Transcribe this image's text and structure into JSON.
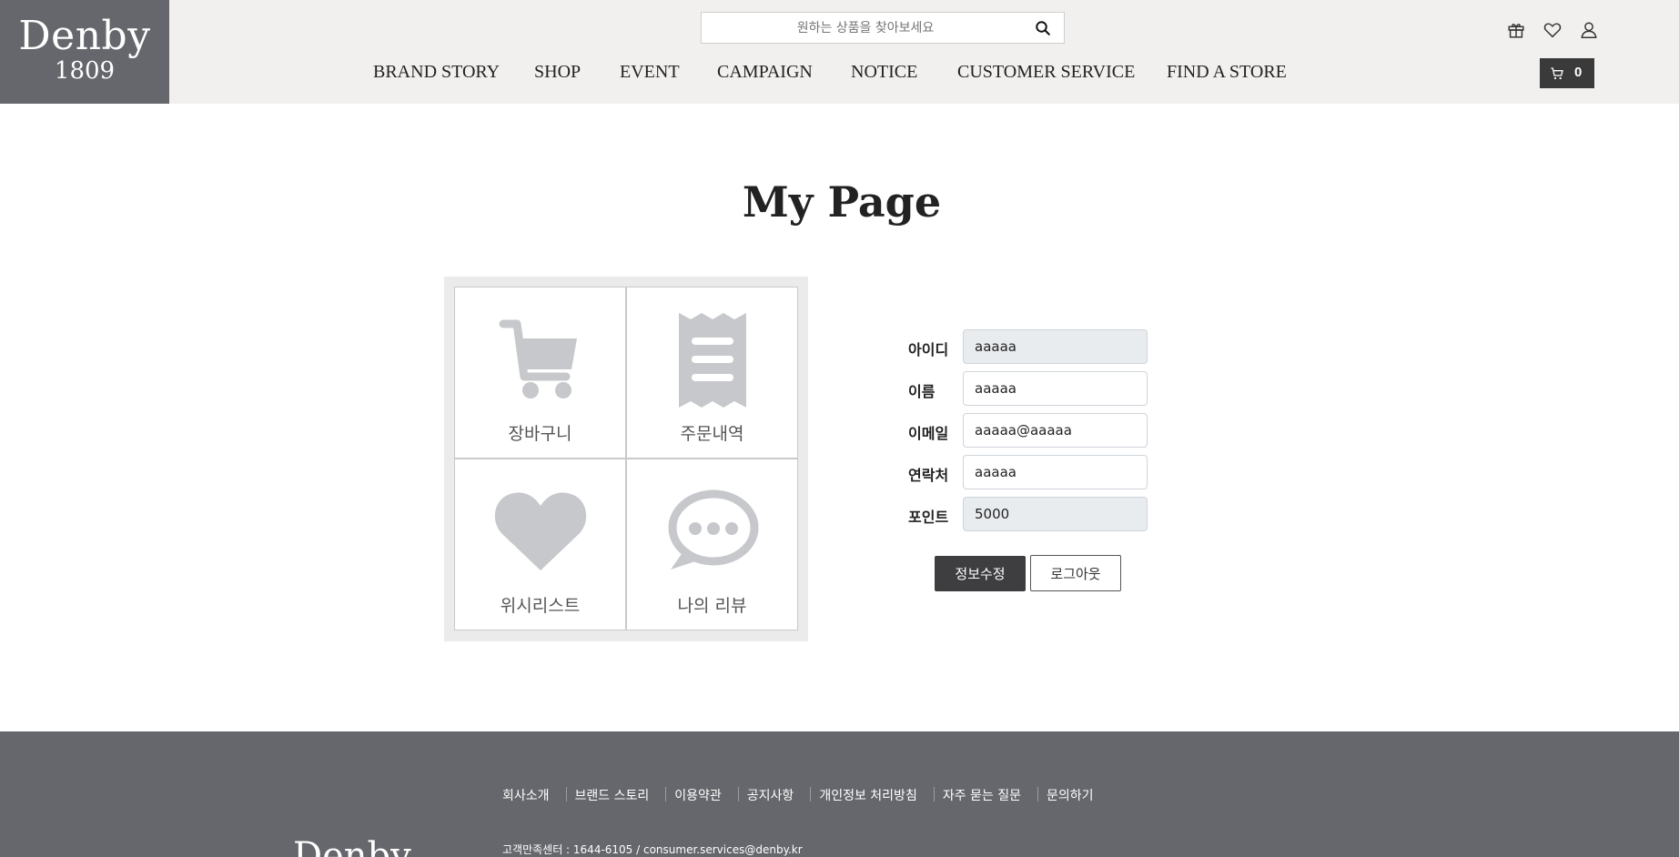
{
  "brand": {
    "name": "Denby",
    "year": "1809"
  },
  "search": {
    "placeholder": "원하는 상품을 찾아보세요"
  },
  "header_icons": [
    "gift-icon",
    "heart-icon",
    "user-icon"
  ],
  "cart": {
    "count": "0"
  },
  "nav": {
    "items": [
      {
        "label": "BRAND STORY"
      },
      {
        "label": "SHOP"
      },
      {
        "label": "EVENT"
      },
      {
        "label": "CAMPAIGN"
      },
      {
        "label": "NOTICE"
      },
      {
        "label": "CUSTOMER SERVICE"
      },
      {
        "label": "FIND A STORE"
      }
    ]
  },
  "page": {
    "title": "My Page"
  },
  "menu": {
    "tiles": [
      {
        "label": "장바구니",
        "icon": "cart-icon"
      },
      {
        "label": "주문내역",
        "icon": "receipt-icon"
      },
      {
        "label": "위시리스트",
        "icon": "heart-icon"
      },
      {
        "label": "나의 리뷰",
        "icon": "chat-icon"
      }
    ]
  },
  "profile": {
    "fields": [
      {
        "label": "아이디",
        "value": "aaaaa",
        "readonly": true
      },
      {
        "label": "이름",
        "value": "aaaaa",
        "readonly": false
      },
      {
        "label": "이메일",
        "value": "aaaaa@aaaaa",
        "readonly": false
      },
      {
        "label": "연락처",
        "value": "aaaaa",
        "readonly": false
      },
      {
        "label": "포인트",
        "value": "5000",
        "readonly": true
      }
    ],
    "edit_label": "정보수정",
    "logout_label": "로그아웃"
  },
  "footer": {
    "links": [
      {
        "label": "회사소개"
      },
      {
        "label": "브랜드 스토리"
      },
      {
        "label": "이용약관"
      },
      {
        "label": "공지사항"
      },
      {
        "label": "개인정보 처리방침"
      },
      {
        "label": "자주 묻는 질문"
      },
      {
        "label": "문의하기"
      }
    ],
    "contact": "고객만족센터 : 1644-6105 / consumer.services@denby.kr",
    "logo": "Denby"
  },
  "colors": {
    "header_bg": "#f1f0ee",
    "logo_bg": "#66676c",
    "footer_bg": "#66676c",
    "icon_gray": "#c6c8cb",
    "button_dark": "#3e3e40"
  }
}
